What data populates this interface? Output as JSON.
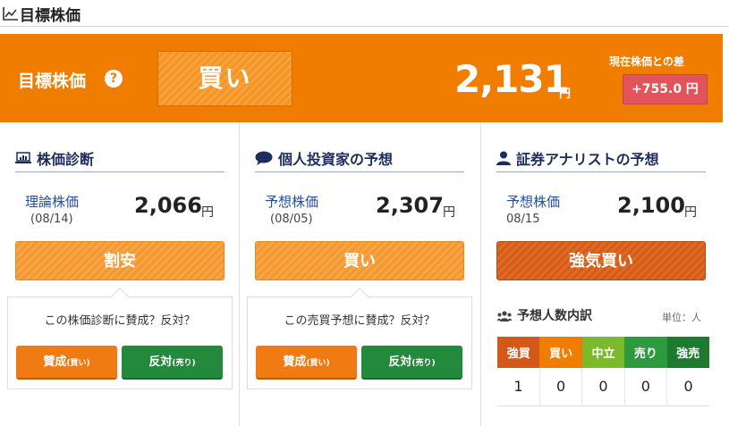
{
  "section": {
    "title": "目標株価",
    "icon": "line-chart-icon"
  },
  "banner": {
    "title": "目標株価",
    "help_icon": "?",
    "rating": "買い",
    "price": "2,131",
    "unit": "円",
    "diff_label": "現在株価との差",
    "diff": "+755.0 円",
    "colors": {
      "banner": "#f07d00",
      "diff": "#e0545a"
    }
  },
  "diagnosis": {
    "header": "株価診断",
    "icon": "laptop-chart-icon",
    "label": "理論株価",
    "date": "(08/14)",
    "value": "2,066",
    "unit": "円",
    "rating": "割安",
    "vote": {
      "question": "この株価診断に賛成？反対？",
      "yes": "賛成",
      "yes_sub": "(買い)",
      "no": "反対",
      "no_sub": "(売り)"
    }
  },
  "individual": {
    "header": "個人投資家の予想",
    "icon": "speech-bubble-icon",
    "label": "予想株価",
    "date": "(08/05)",
    "value": "2,307",
    "unit": "円",
    "rating": "買い",
    "vote": {
      "question": "この売買予想に賛成？反対？",
      "yes": "賛成",
      "yes_sub": "(買い)",
      "no": "反対",
      "no_sub": "(売り)"
    }
  },
  "analyst": {
    "header": "証券アナリストの予想",
    "icon": "person-icon",
    "label": "予想株価",
    "date": "08/15",
    "value": "2,100",
    "unit": "円",
    "rating": "強気買い",
    "breakdown": {
      "title": "予想人数内訳",
      "icon": "people-icon",
      "unit": "単位：人",
      "headers": [
        "強買",
        "買い",
        "中立",
        "売り",
        "強売"
      ],
      "header_colors": [
        "#d4581a",
        "#f07d00",
        "#7bb92d",
        "#2e9a3e",
        "#1e7a2f"
      ],
      "counts": [
        "1",
        "0",
        "0",
        "0",
        "0"
      ]
    }
  }
}
